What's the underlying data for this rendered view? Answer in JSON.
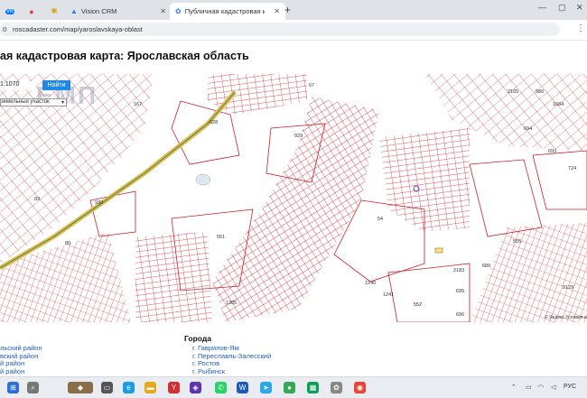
{
  "browser": {
    "tabs": [
      {
        "label": "VK",
        "kind": "pinned"
      },
      {
        "label": "",
        "kind": "pinned"
      },
      {
        "label": "",
        "kind": "pinned"
      },
      {
        "label": "Vision CRM",
        "kind": "normal"
      },
      {
        "label": "Публичная кадастровая карта",
        "kind": "active"
      }
    ],
    "new_tab_label": "+",
    "address": "roscadaster.com/map/yaroslavskaya-oblast"
  },
  "page": {
    "title": "ая кадастровая карта: Ярославская область",
    "zoom_value": "1:1070",
    "find_label": "Найти",
    "type_select": "земельный участок",
    "watermark": "ЕМП",
    "map_copyright": "© Яндекс  Условия и",
    "parcel_labels": [
      "167",
      "928",
      "929",
      "67",
      "2165",
      "580",
      "1684",
      "930",
      "83",
      "551",
      "54",
      "693",
      "694",
      "724",
      "80",
      "2183",
      "689",
      "555",
      "1241",
      "1240",
      "552",
      "695",
      "696",
      "2129",
      "1305"
    ]
  },
  "footer": {
    "districts": [
      "льский район",
      "вский район",
      "й район",
      "й район"
    ],
    "cities_title": "Города",
    "cities": [
      "г. Гаврилов-Ям",
      "г. Переславль-Залесский",
      "г. Ростов",
      "г. Рыбинск"
    ]
  },
  "taskbar": {
    "lang": "РУС",
    "colors": {
      "chrome": "#dfe3e8",
      "accent": "#1e88e5",
      "parcel": "#cc1f2a",
      "road": "#e6b84c",
      "link": "#1f5fbf"
    }
  }
}
